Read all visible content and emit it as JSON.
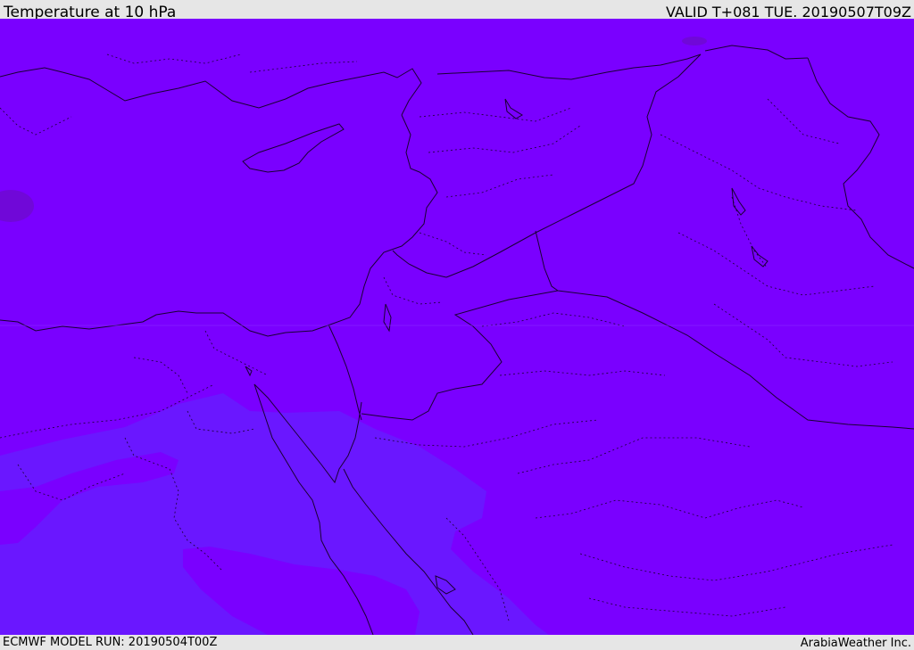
{
  "header": {
    "title": "Temperature at 10 hPa",
    "valid": "VALID T+081 TUE. 20190507T09Z"
  },
  "footer": {
    "model_run": "ECMWF MODEL RUN: 20190504T00Z",
    "credit": "ArabiaWeather Inc."
  },
  "map": {
    "region": "Eastern Mediterranean / Middle East",
    "colors": {
      "main_field": "#7a00ff",
      "cool_field": "#6a17ff",
      "warm_spot": "#7008d8",
      "borders": "#1a0033"
    }
  }
}
